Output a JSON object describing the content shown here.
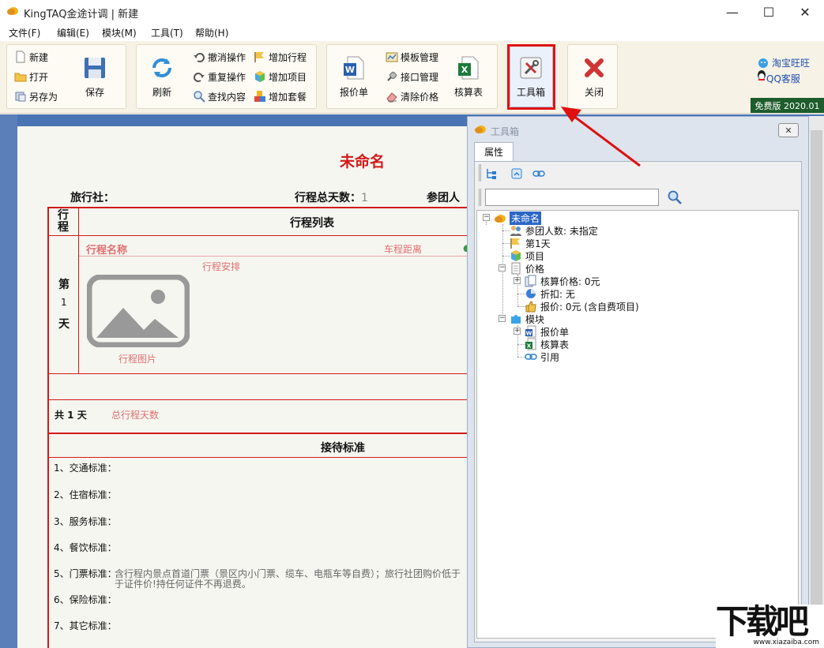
{
  "window": {
    "title": "KingTAQ金途计调 | 新建",
    "minimize_glyph": "—",
    "maximize_glyph": "☐",
    "close_glyph": "✕"
  },
  "menu": [
    "文件(F)",
    "编辑(E)",
    "模块(M)",
    "工具(T)",
    "帮助(H)"
  ],
  "ribbon": {
    "file": {
      "new": "新建",
      "open": "打开",
      "save_as": "另存为",
      "save": "保存"
    },
    "edit": {
      "refresh": "刷新",
      "undo": "撤消操作",
      "redo": "重复操作",
      "find": "查找内容",
      "add_trip": "增加行程",
      "add_item": "增加项目",
      "add_package": "增加套餐"
    },
    "tools": {
      "quote": "报价单",
      "template_mgr": "模板管理",
      "interface_mgr": "接口管理",
      "clear_price": "清除价格",
      "accounting": "核算表",
      "toolbox": "工具箱",
      "close": "关闭"
    },
    "links": {
      "taobao": "淘宝旺旺",
      "qq": "QQ客服"
    },
    "version": "免费版 2020.01"
  },
  "doc": {
    "title": "未命名",
    "agency_label": "旅行社：",
    "total_days_label": "行程总天数：",
    "total_days_value": "1",
    "group_label": "参团人",
    "trip_col": "行程",
    "trip_list": "行程列表",
    "trip_name": "行程名称",
    "distance": "车程距离",
    "arrange": "行程安排",
    "image_label": "行程图片",
    "day_label_1": "第",
    "day_label_2": "1",
    "day_label_3": "天",
    "total_line": "共 1 天",
    "total_hint": "总行程天数",
    "standard_title": "接待标准",
    "standards": [
      {
        "label": "1、交通标准：",
        "text": ""
      },
      {
        "label": "2、住宿标准：",
        "text": ""
      },
      {
        "label": "3、服务标准：",
        "text": ""
      },
      {
        "label": "4、餐饮标准：",
        "text": ""
      },
      {
        "label": "5、门票标准：",
        "text": "含行程内景点首道门票（景区内小门票、缆车、电瓶车等自费）；旅行社团购价低于",
        "text2": "于证件价!持任何证件不再退费。"
      },
      {
        "label": "6、保险标准：",
        "text": ""
      },
      {
        "label": "7、其它标准：",
        "text": ""
      }
    ]
  },
  "toolbox": {
    "title": "工具箱",
    "close_glyph": "✕",
    "tab": "属性",
    "search_placeholder": "",
    "tree": {
      "root": "未命名",
      "group": "参团人数: 未指定",
      "day1": "第1天",
      "item": "项目",
      "price": "价格",
      "accounting_price": "核算价格: 0元",
      "discount": "折扣: 无",
      "quote": "报价: 0元 (含自费项目)",
      "module": "模块",
      "quote_sheet": "报价单",
      "accounting_sheet": "核算表",
      "reference": "引用"
    }
  },
  "watermark": {
    "text": "下载吧",
    "url": "www.xiazaiba.com"
  }
}
